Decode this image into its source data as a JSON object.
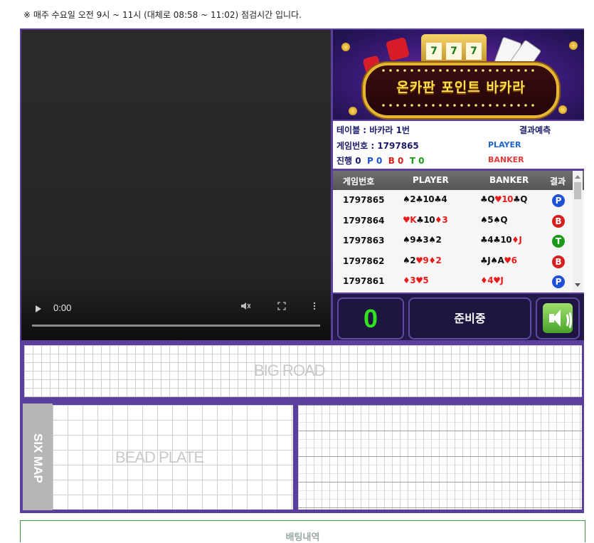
{
  "notice": "※ 매주 수요일 오전 9시 ~ 11시 (대체로 08:58 ~ 11:02) 점검시간 입니다.",
  "video": {
    "time": "0:00",
    "play_icon": "play-icon",
    "mute_icon": "mute-icon",
    "fullscreen_icon": "fullscreen-icon",
    "more_icon": "more-options-icon"
  },
  "banner": {
    "title": "온카판 포인트 바카라",
    "reels": [
      "7",
      "7",
      "7"
    ]
  },
  "info": {
    "table_label": "테이블 : 바카라 1번",
    "game_label": "게임번호 : 1797865",
    "progress_label": "진행",
    "progress_count": "0",
    "p_label": "P",
    "p_count": "0",
    "b_label": "B",
    "b_count": "0",
    "t_label": "T",
    "t_count": "0",
    "predict_label": "결과예측",
    "predict_player": "PLAYER",
    "predict_banker": "BANKER"
  },
  "history": {
    "headers": [
      "게임번호",
      "PLAYER",
      "BANKER",
      "결과"
    ],
    "rows": [
      {
        "id": "1797865",
        "player": [
          [
            "♠",
            "2",
            "k"
          ],
          [
            "♣",
            "10",
            "k"
          ],
          [
            "♣",
            "4",
            "k"
          ]
        ],
        "banker": [
          [
            "♣",
            "Q",
            "k"
          ],
          [
            "♥",
            "10",
            "r"
          ],
          [
            "♣",
            "Q",
            "k"
          ]
        ],
        "result": "P"
      },
      {
        "id": "1797864",
        "player": [
          [
            "♥",
            "K",
            "r"
          ],
          [
            "♣",
            "10",
            "k"
          ],
          [
            "♦",
            "3",
            "r"
          ]
        ],
        "banker": [
          [
            "♠",
            "5",
            "k"
          ],
          [
            "♠",
            "Q",
            "k"
          ]
        ],
        "result": "B"
      },
      {
        "id": "1797863",
        "player": [
          [
            "♠",
            "9",
            "k"
          ],
          [
            "♣",
            "3",
            "k"
          ],
          [
            "♠",
            "2",
            "k"
          ]
        ],
        "banker": [
          [
            "♣",
            "4",
            "k"
          ],
          [
            "♣",
            "10",
            "k"
          ],
          [
            "♦",
            "J",
            "r"
          ]
        ],
        "result": "T"
      },
      {
        "id": "1797862",
        "player": [
          [
            "♠",
            "2",
            "k"
          ],
          [
            "♥",
            "9",
            "r"
          ],
          [
            "♦",
            "2",
            "r"
          ]
        ],
        "banker": [
          [
            "♣",
            "J",
            "k"
          ],
          [
            "♠",
            "A",
            "k"
          ],
          [
            "♥",
            "6",
            "r"
          ]
        ],
        "result": "B"
      },
      {
        "id": "1797861",
        "player": [
          [
            "♦",
            "3",
            "r"
          ],
          [
            "♥",
            "5",
            "r"
          ]
        ],
        "banker": [
          [
            "♦",
            "4",
            "r"
          ],
          [
            "♥",
            "J",
            "r"
          ]
        ],
        "result": "P"
      }
    ]
  },
  "controls": {
    "counter": "0",
    "status": "준비중",
    "sound_icon": "speaker-icon"
  },
  "roads": {
    "big_road": "BIG ROAD",
    "bead_plate": "BEAD PLATE",
    "six_map": "SIX MAP"
  },
  "bet_panel": {
    "title": "배팅내역"
  },
  "colors": {
    "frame": "#5b3f9c",
    "player": "#1e50d8",
    "banker": "#d61f1f",
    "tie": "#1a9a1a",
    "counter": "#33e21f"
  }
}
